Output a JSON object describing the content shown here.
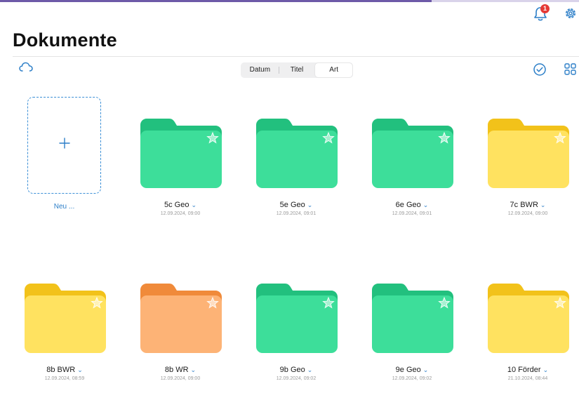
{
  "header": {
    "title": "Dokumente",
    "notification_count": "1"
  },
  "sort": {
    "options": [
      "Datum",
      "Titel",
      "Art"
    ],
    "active": "Art"
  },
  "new_item": {
    "label": "Neu ..."
  },
  "colors": {
    "green": "#3dde9a",
    "green_dark": "#22c07e",
    "yellow": "#ffe260",
    "yellow_dark": "#f2c21a",
    "orange": "#fdb376",
    "orange_dark": "#f08a3a",
    "accent": "#2d7fc8"
  },
  "folders": [
    {
      "name": "5c Geo",
      "date": "12.09.2024, 09:00",
      "color": "green"
    },
    {
      "name": "5e Geo",
      "date": "12.09.2024, 09:01",
      "color": "green"
    },
    {
      "name": "6e Geo",
      "date": "12.09.2024, 09:01",
      "color": "green"
    },
    {
      "name": "7c BWR",
      "date": "12.09.2024, 09:00",
      "color": "yellow"
    },
    {
      "name": "8b BWR",
      "date": "12.09.2024, 08:59",
      "color": "yellow"
    },
    {
      "name": "8b WR",
      "date": "12.09.2024, 09:00",
      "color": "orange"
    },
    {
      "name": "9b Geo",
      "date": "12.09.2024, 09:02",
      "color": "green"
    },
    {
      "name": "9e Geo",
      "date": "12.09.2024, 09:02",
      "color": "green"
    },
    {
      "name": "10 Förder",
      "date": "21.10.2024, 08:44",
      "color": "yellow"
    }
  ],
  "icons": {
    "chevron": "⌄"
  }
}
